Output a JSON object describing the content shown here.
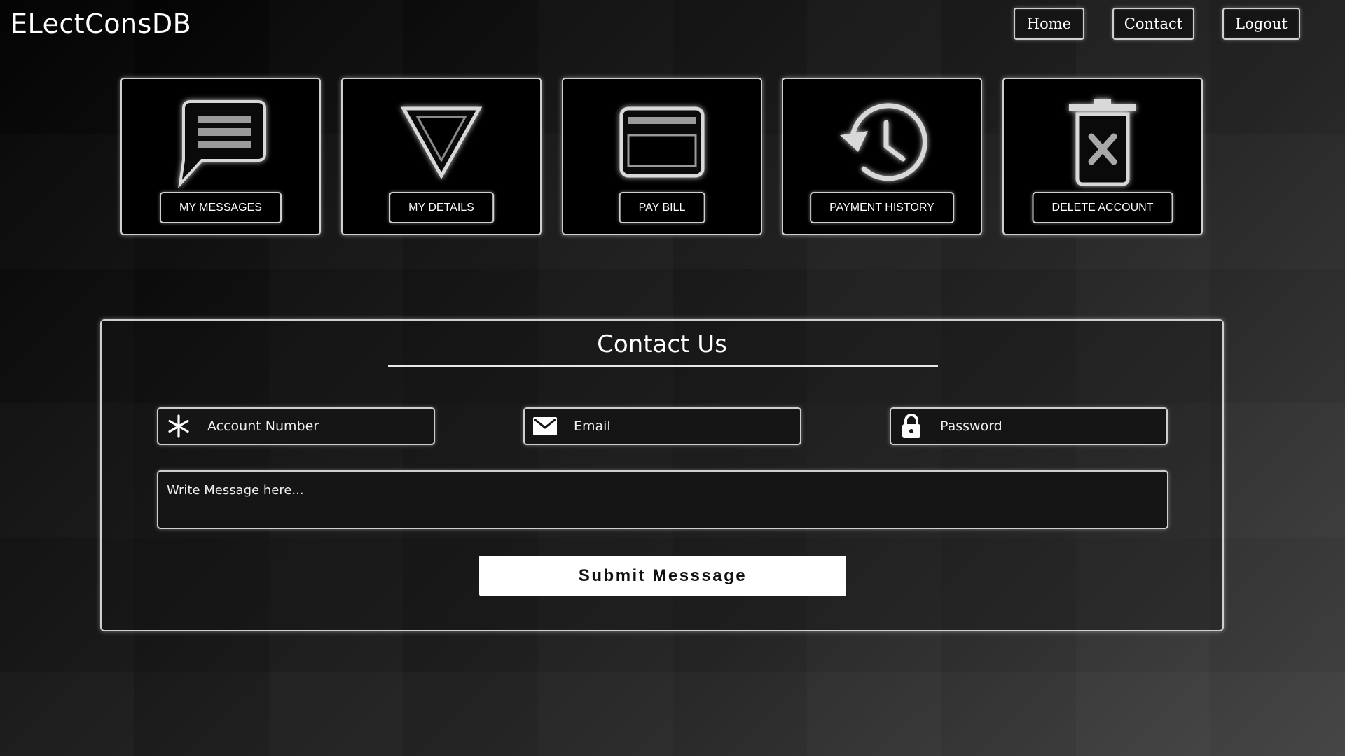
{
  "header": {
    "brand": "ELectConsDB",
    "nav": {
      "home": "Home",
      "contact": "Contact",
      "logout": "Logout"
    }
  },
  "dashboard": {
    "tiles": [
      {
        "label": "MY MESSAGES",
        "icon": "message-icon"
      },
      {
        "label": "MY DETAILS",
        "icon": "triangle-down-icon"
      },
      {
        "label": "PAY BILL",
        "icon": "credit-card-icon"
      },
      {
        "label": "PAYMENT HISTORY",
        "icon": "history-icon"
      },
      {
        "label": "DELETE ACCOUNT",
        "icon": "trash-icon"
      }
    ]
  },
  "contact_form": {
    "title": "Contact Us",
    "account_number_placeholder": "Account Number",
    "email_placeholder": "Email",
    "password_placeholder": "Password",
    "message_placeholder": "Write Message here...",
    "submit_label": "Submit Messsage",
    "icons": {
      "account": "asterisk-icon",
      "email": "envelope-icon",
      "password": "lock-icon"
    }
  },
  "colors": {
    "accent_border": "#cfcfcf",
    "tile_background": "#000000",
    "submit_background": "#ffffff"
  }
}
